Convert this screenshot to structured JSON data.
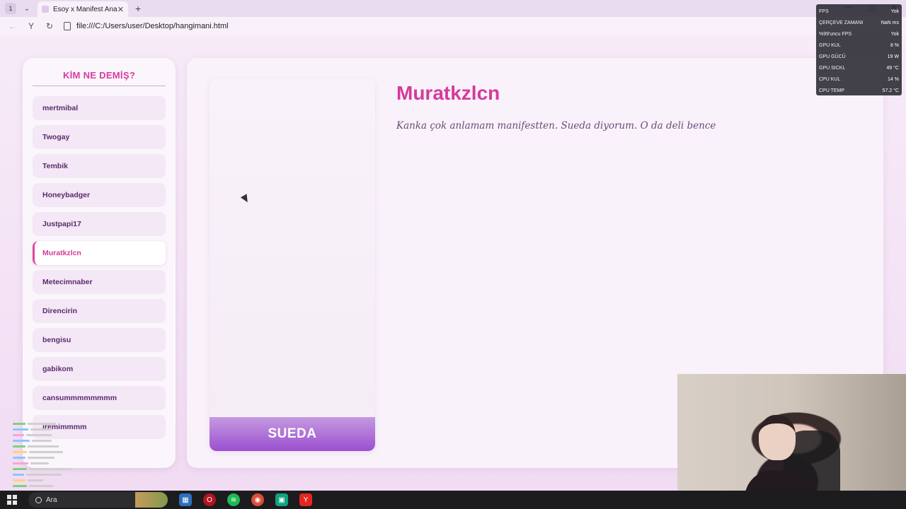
{
  "browser": {
    "tab_count": "1",
    "tab_title": "Esoy x Manifest Analiz",
    "url": "file:///C:/Users/user/Desktop/hangimani.html"
  },
  "sidebar": {
    "title": "KİM NE DEMİŞ?",
    "items": [
      {
        "label": "mertmibal"
      },
      {
        "label": "Twogay"
      },
      {
        "label": "Tembik"
      },
      {
        "label": "Honeybadger"
      },
      {
        "label": "Justpapi17"
      },
      {
        "label": "Muratkzlcn",
        "active": true
      },
      {
        "label": "Metecimnaber"
      },
      {
        "label": "Direnсirin"
      },
      {
        "label": "bengisu"
      },
      {
        "label": "gabikom"
      },
      {
        "label": "cansummmmmmmm"
      },
      {
        "label": "iremimmmm"
      }
    ]
  },
  "main": {
    "card_label": "SUEDA",
    "title": "Muratkzlcn",
    "quote": "Kanka çok anlamam manifestten. Sueda diyorum. O da deli bence"
  },
  "fps_overlay": {
    "rows": [
      {
        "label": "FPS",
        "value": "Yok"
      },
      {
        "label": "ÇERÇEVE ZAMANI",
        "value": "NaN ms"
      },
      {
        "label": "%99'uncu FPS",
        "value": "Yok"
      },
      {
        "label": "GPU KUL",
        "value": "8 %"
      },
      {
        "label": "GPU GÜCÜ",
        "value": "19 W"
      },
      {
        "label": "GPU SICKL",
        "value": "49 °C"
      },
      {
        "label": "CPU KUL",
        "value": "14 %"
      },
      {
        "label": "CPU TEMP",
        "value": "57.2 °C"
      }
    ]
  },
  "taskbar": {
    "search_label": "Ara"
  },
  "colors": {
    "accent_pink": "#d53a9d",
    "card_label_gradient_end": "#9c4fd0",
    "sidebar_text": "#5a2b6b"
  }
}
